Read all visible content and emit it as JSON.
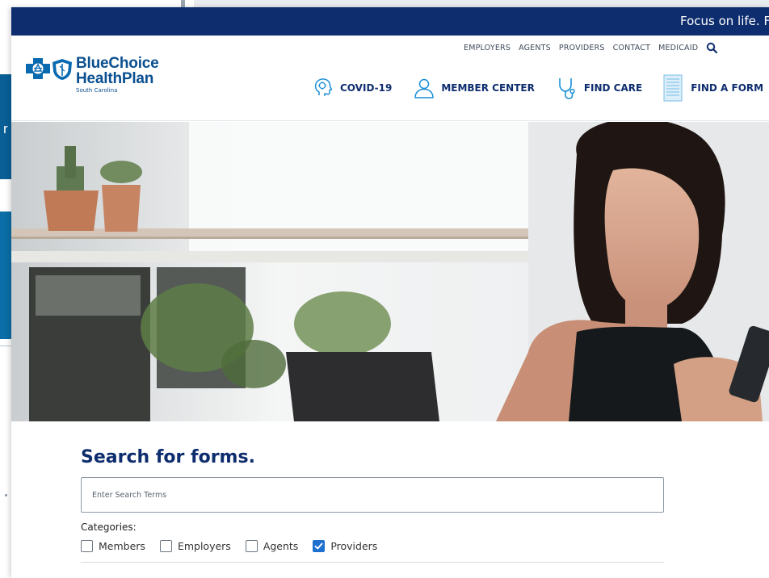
{
  "topbar": {
    "tagline": "Focus on life. Foc"
  },
  "utility_nav": [
    "EMPLOYERS",
    "AGENTS",
    "PROVIDERS",
    "CONTACT",
    "MEDICAID"
  ],
  "logo": {
    "line1": "BlueChoice",
    "line2": "HealthPlan",
    "line3": "South Carolina"
  },
  "main_nav": [
    {
      "label": "COVID-19",
      "icon": "covid-head-icon"
    },
    {
      "label": "MEMBER CENTER",
      "icon": "person-icon"
    },
    {
      "label": "FIND CARE",
      "icon": "stethoscope-icon"
    },
    {
      "label": "FIND A FORM",
      "icon": "document-icon"
    }
  ],
  "search": {
    "title": "Search for forms.",
    "placeholder": "Enter Search Terms",
    "categories_label": "Categories:",
    "categories": [
      {
        "label": "Members",
        "checked": false
      },
      {
        "label": "Employers",
        "checked": false
      },
      {
        "label": "Agents",
        "checked": false
      },
      {
        "label": "Providers",
        "checked": true
      }
    ]
  },
  "colors": {
    "navy": "#0e2d6e",
    "brand_blue": "#0a4f8f",
    "checkbox_blue": "#1d6fd0"
  }
}
